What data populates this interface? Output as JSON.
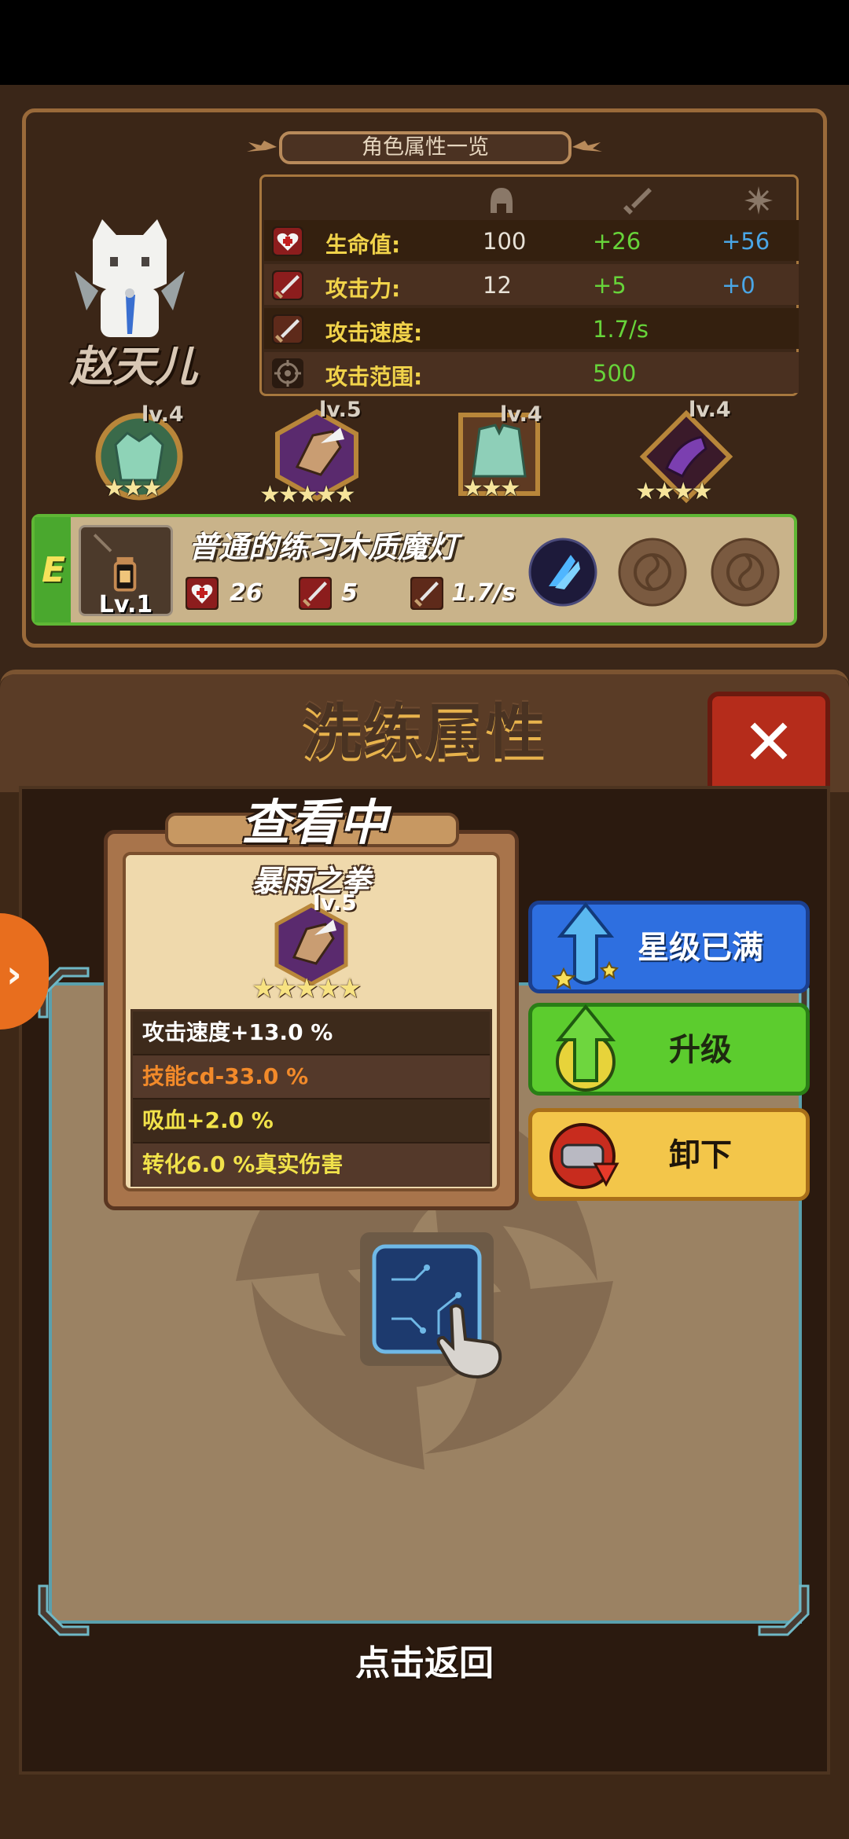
{
  "top_panel": {
    "title": "角色属性一览",
    "character_name": "赵天儿",
    "stat_columns": [
      "helmet-icon",
      "sword-icon",
      "sparkle-icon"
    ],
    "stats": [
      {
        "icon": "heart-icon",
        "label": "生命值:",
        "base": "100",
        "bonus": "+26",
        "extra": "+56"
      },
      {
        "icon": "sword-icon",
        "label": "攻击力:",
        "base": "12",
        "bonus": "+5",
        "extra": "+0"
      },
      {
        "icon": "sword-icon",
        "label": "攻击速度:",
        "base": "",
        "bonus": "1.7/s",
        "extra": ""
      },
      {
        "icon": "crosshair-icon",
        "label": "攻击范围:",
        "base": "",
        "bonus": "500",
        "extra": ""
      }
    ],
    "equipment": [
      {
        "level": "lv.4",
        "stars": "★★★",
        "icon": "armor-icon"
      },
      {
        "level": "lv.5",
        "stars": "★★★★★",
        "icon": "gauntlet-icon"
      },
      {
        "level": "lv.4",
        "stars": "★★★",
        "icon": "coat-icon"
      },
      {
        "level": "lv.4",
        "stars": "★★★★",
        "icon": "boot-icon"
      }
    ],
    "weapon": {
      "grade": "E",
      "level": "Lv.1",
      "name": "普通的练习木质魔灯",
      "hp": "26",
      "attack": "5",
      "speed": "1.7/s"
    }
  },
  "reforge": {
    "title": "洗练属性",
    "close_label": "✕",
    "viewing_label": "查看中",
    "item": {
      "name": "暴雨之拳",
      "level": "lv.5",
      "stars": "★★★★★",
      "attributes": [
        {
          "text": "攻击速度+13.0 %",
          "color": "#ffffff"
        },
        {
          "text": "技能cd-33.0 %",
          "color": "#f28a2a"
        },
        {
          "text": "吸血+2.0 %",
          "color": "#f1e24a"
        },
        {
          "text": "转化6.0 %真实伤害",
          "color": "#f1e24a"
        }
      ]
    },
    "buttons": {
      "star_full": "星级已满",
      "upgrade": "升级",
      "unequip": "卸下"
    },
    "tap_return": "点击返回",
    "side_tab": "›"
  },
  "colors": {
    "stat_label": "#f1d34a",
    "bonus_green": "#67d43a",
    "extra_blue": "#4aa6e6",
    "star_button": "#2e6fe0",
    "upgrade_button": "#5ccc2e",
    "unequip_button": "#f3c64a",
    "close_button": "#b52c1b"
  }
}
